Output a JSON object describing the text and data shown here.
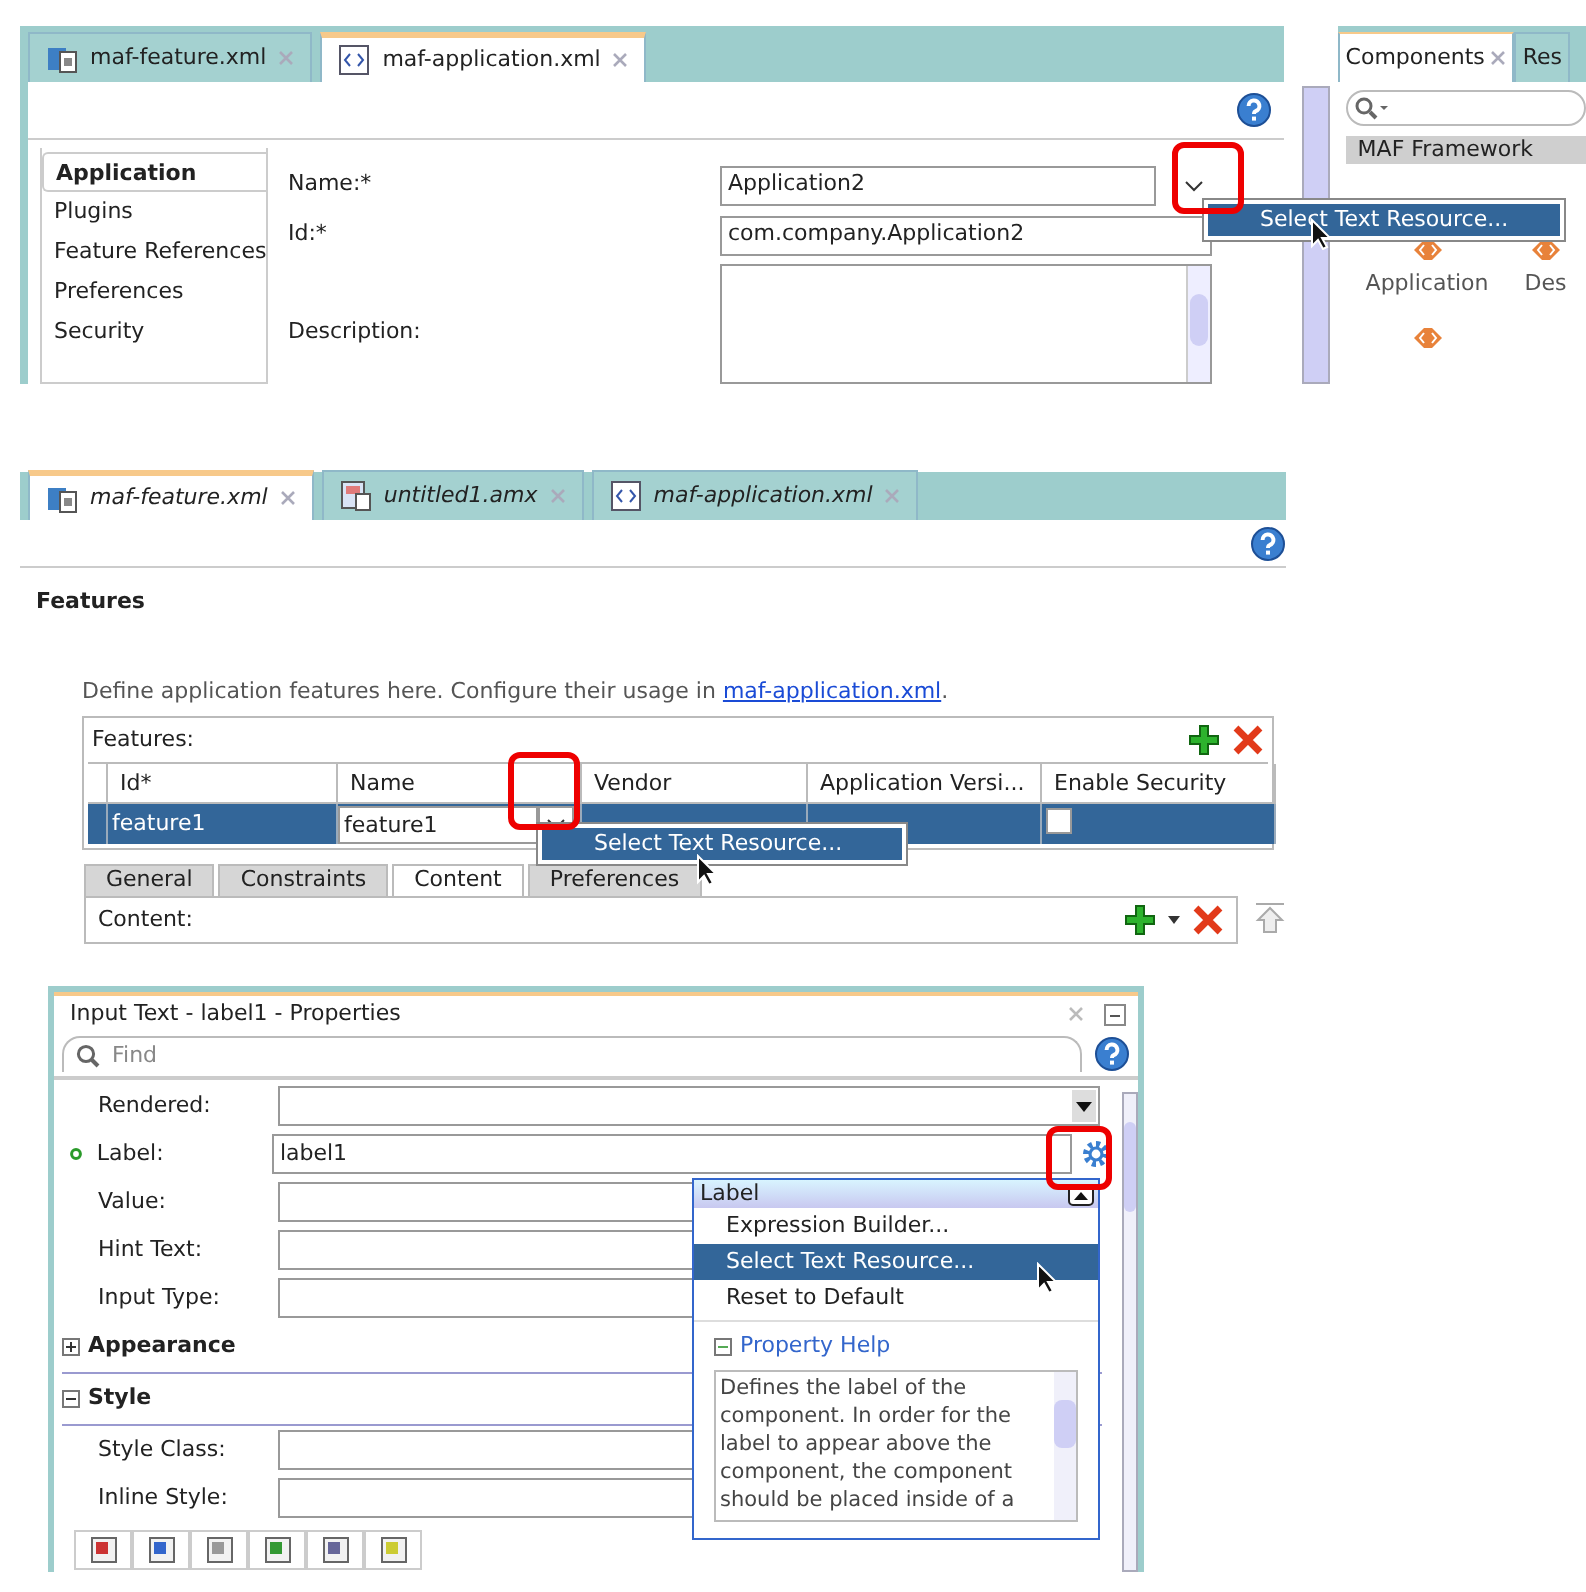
{
  "application_editor": {
    "tabs": [
      {
        "label": "maf-feature.xml",
        "selected": false,
        "kind": "feature"
      },
      {
        "label": "maf-application.xml",
        "selected": true,
        "kind": "xml"
      }
    ],
    "nav": [
      {
        "label": "Application",
        "selected": true
      },
      {
        "label": "Plugins",
        "selected": false
      },
      {
        "label": "Feature References",
        "selected": false
      },
      {
        "label": "Preferences",
        "selected": false
      },
      {
        "label": "Security",
        "selected": false
      }
    ],
    "fields": [
      {
        "label": "Name:*",
        "value": "Application2",
        "kind": "dropdown"
      },
      {
        "label": "Id:*",
        "value": "com.company.Application2",
        "kind": "text"
      },
      {
        "label": "Description:",
        "kind": "textarea"
      }
    ],
    "popup_menu": [
      {
        "label": "Select Text Resource...",
        "selected": true
      }
    ]
  },
  "components_palette": {
    "tabs": [
      {
        "label": "Components",
        "selected": true
      },
      {
        "label": "Res",
        "selected": false
      }
    ],
    "category": "MAF Framework",
    "items": [
      {
        "label": "Application"
      },
      {
        "label": "Des"
      }
    ]
  },
  "feature_editor": {
    "tabs": [
      {
        "label": "maf-feature.xml",
        "selected": true,
        "kind": "feature"
      },
      {
        "label": "untitled1.amx",
        "selected": false,
        "kind": "page"
      },
      {
        "label": "maf-application.xml",
        "selected": false,
        "kind": "xml"
      }
    ],
    "heading": "Features",
    "intro": "Define application features here. Configure their usage in ",
    "intro_link": "maf-application.xml",
    "intro_end": ".",
    "table": {
      "title": "Features:",
      "columns": [
        "Id*",
        "Name",
        "Vendor",
        "Application Versi...",
        "Enable Security"
      ],
      "rows": [
        {
          "id": "feature1",
          "name": "feature1",
          "enable_security": false,
          "selected": true
        }
      ]
    },
    "popup_menu": [
      {
        "label": "Select Text Resource...",
        "selected": true
      }
    ],
    "subtabs": [
      {
        "label": "General",
        "selected": false
      },
      {
        "label": "Constraints",
        "selected": false
      },
      {
        "label": "Content",
        "selected": true
      },
      {
        "label": "Preferences",
        "selected": false
      }
    ],
    "content_label": "Content:"
  },
  "properties_panel": {
    "title": "Input Text - label1 - Properties",
    "search": {
      "placeholder": "Find"
    },
    "properties": [
      {
        "label": "Rendered:",
        "kind": "dropdown",
        "modified": false
      },
      {
        "label": "Label:",
        "value": "label1",
        "kind": "text",
        "modified": true
      },
      {
        "label": "Value:",
        "kind": "text",
        "modified": false
      },
      {
        "label": "Hint Text:",
        "kind": "text",
        "modified": false
      },
      {
        "label": "Input Type:",
        "kind": "text",
        "modified": false
      }
    ],
    "sections": [
      {
        "label": "Appearance",
        "expanded": false
      },
      {
        "label": "Style",
        "expanded": true,
        "properties": [
          {
            "label": "Style Class:"
          },
          {
            "label": "Inline Style:"
          }
        ]
      }
    ],
    "popup": {
      "title": "Label",
      "items": [
        {
          "label": "Expression Builder...",
          "selected": false
        },
        {
          "label": "Select Text Resource...",
          "selected": true
        },
        {
          "label": "Reset to Default",
          "selected": false
        }
      ],
      "help_title": "Property Help",
      "help_expanded": true,
      "help_text": "Defines the label of the component. In order for the label to appear above the component, the component should be placed inside of a"
    }
  }
}
